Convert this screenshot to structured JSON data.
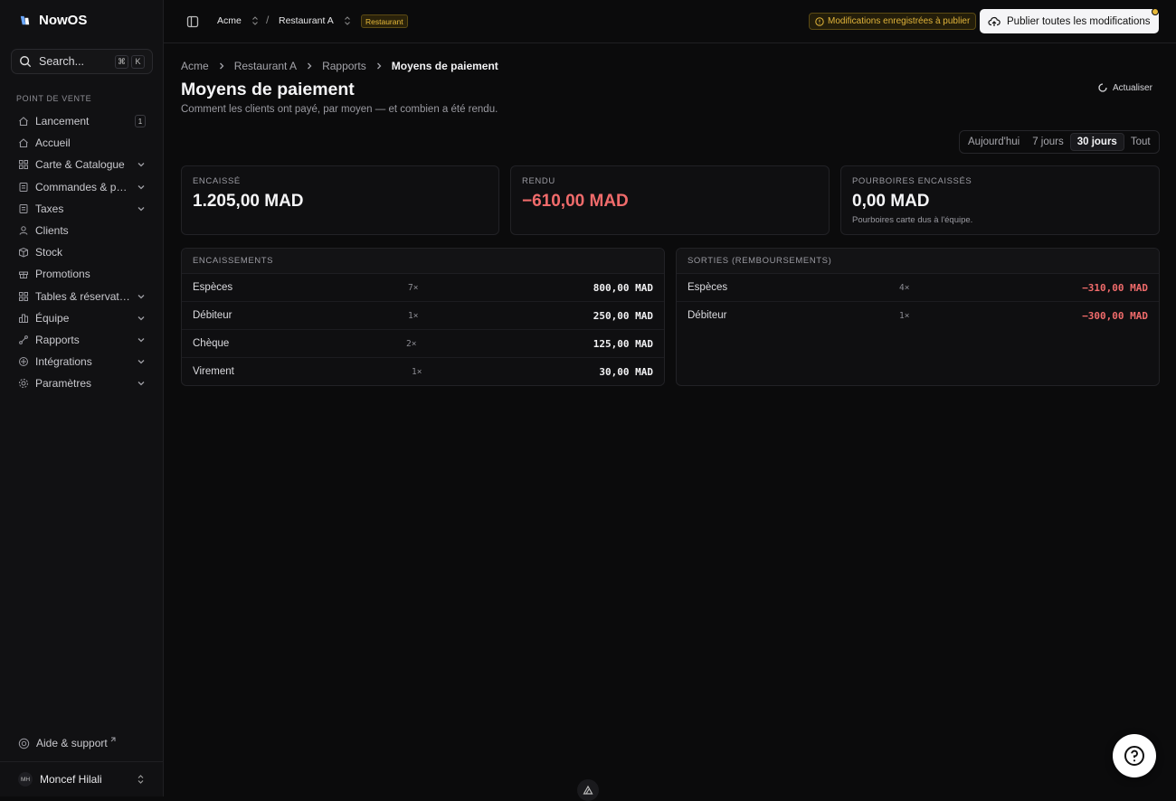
{
  "app": {
    "name": "NowOS"
  },
  "search": {
    "placeholder": "Search...",
    "kbd": [
      "⌘",
      "K"
    ]
  },
  "sidebar": {
    "section": "POINT DE VENTE",
    "items": [
      {
        "label": "Lancement",
        "icon": "home-icon",
        "badge": "1",
        "chevron": false
      },
      {
        "label": "Accueil",
        "icon": "home-icon",
        "chevron": false
      },
      {
        "label": "Carte & Catalogue",
        "icon": "grid-icon",
        "chevron": true
      },
      {
        "label": "Commandes & paiements",
        "icon": "receipt-icon",
        "chevron": true
      },
      {
        "label": "Taxes",
        "icon": "receipt-icon",
        "chevron": true
      },
      {
        "label": "Clients",
        "icon": "users-icon",
        "chevron": false
      },
      {
        "label": "Stock",
        "icon": "box-icon",
        "chevron": false
      },
      {
        "label": "Promotions",
        "icon": "gift-icon",
        "chevron": false
      },
      {
        "label": "Tables & réservations",
        "icon": "grid-icon",
        "chevron": true
      },
      {
        "label": "Équipe",
        "icon": "team-icon",
        "chevron": true
      },
      {
        "label": "Rapports",
        "icon": "chart-icon",
        "chevron": true
      },
      {
        "label": "Intégrations",
        "icon": "plug-icon",
        "chevron": true
      },
      {
        "label": "Paramètres",
        "icon": "gear-icon",
        "chevron": true
      }
    ],
    "help": "Aide & support",
    "user": {
      "initials": "MH",
      "name": "Moncef Hilali"
    }
  },
  "topbar": {
    "org": "Acme",
    "separator": "/",
    "location": "Restaurant A",
    "location_tag": "Restaurant",
    "pending_label": "Modifications enregistrées à publier",
    "publish_label": "Publier toutes les modifications"
  },
  "breadcrumb": [
    "Acme",
    "Restaurant A",
    "Rapports",
    "Moyens de paiement"
  ],
  "page": {
    "title": "Moyens de paiement",
    "subtitle": "Comment les clients ont payé, par moyen — et combien a été rendu.",
    "refresh_label": "Actualiser"
  },
  "period": {
    "options": [
      "Aujourd'hui",
      "7 jours",
      "30 jours",
      "Tout"
    ],
    "selected": "30 jours"
  },
  "kpis": [
    {
      "label": "ENCAISSÉ",
      "value": "1.205,00 MAD",
      "negative": false
    },
    {
      "label": "RENDU",
      "value": "−610,00 MAD",
      "negative": true
    },
    {
      "label": "POURBOIRES ENCAISSÉS",
      "value": "0,00 MAD",
      "note": "Pourboires carte dus à l'équipe.",
      "negative": false
    }
  ],
  "encaissements": {
    "title": "ENCAISSEMENTS",
    "rows": [
      {
        "method": "Espèces",
        "count": "7×",
        "amount": "800,00 MAD"
      },
      {
        "method": "Débiteur",
        "count": "1×",
        "amount": "250,00 MAD"
      },
      {
        "method": "Chèque",
        "count": "2×",
        "amount": "125,00 MAD"
      },
      {
        "method": "Virement",
        "count": "1×",
        "amount": "30,00 MAD"
      }
    ]
  },
  "sorties": {
    "title": "SORTIES (REMBOURSEMENTS)",
    "rows": [
      {
        "method": "Espèces",
        "count": "4×",
        "amount": "−310,00 MAD"
      },
      {
        "method": "Débiteur",
        "count": "1×",
        "amount": "−300,00 MAD"
      }
    ]
  },
  "colors": {
    "accent_warning": "#e7b93a",
    "negative": "#f06b6b",
    "background": "#0b0b0c"
  }
}
